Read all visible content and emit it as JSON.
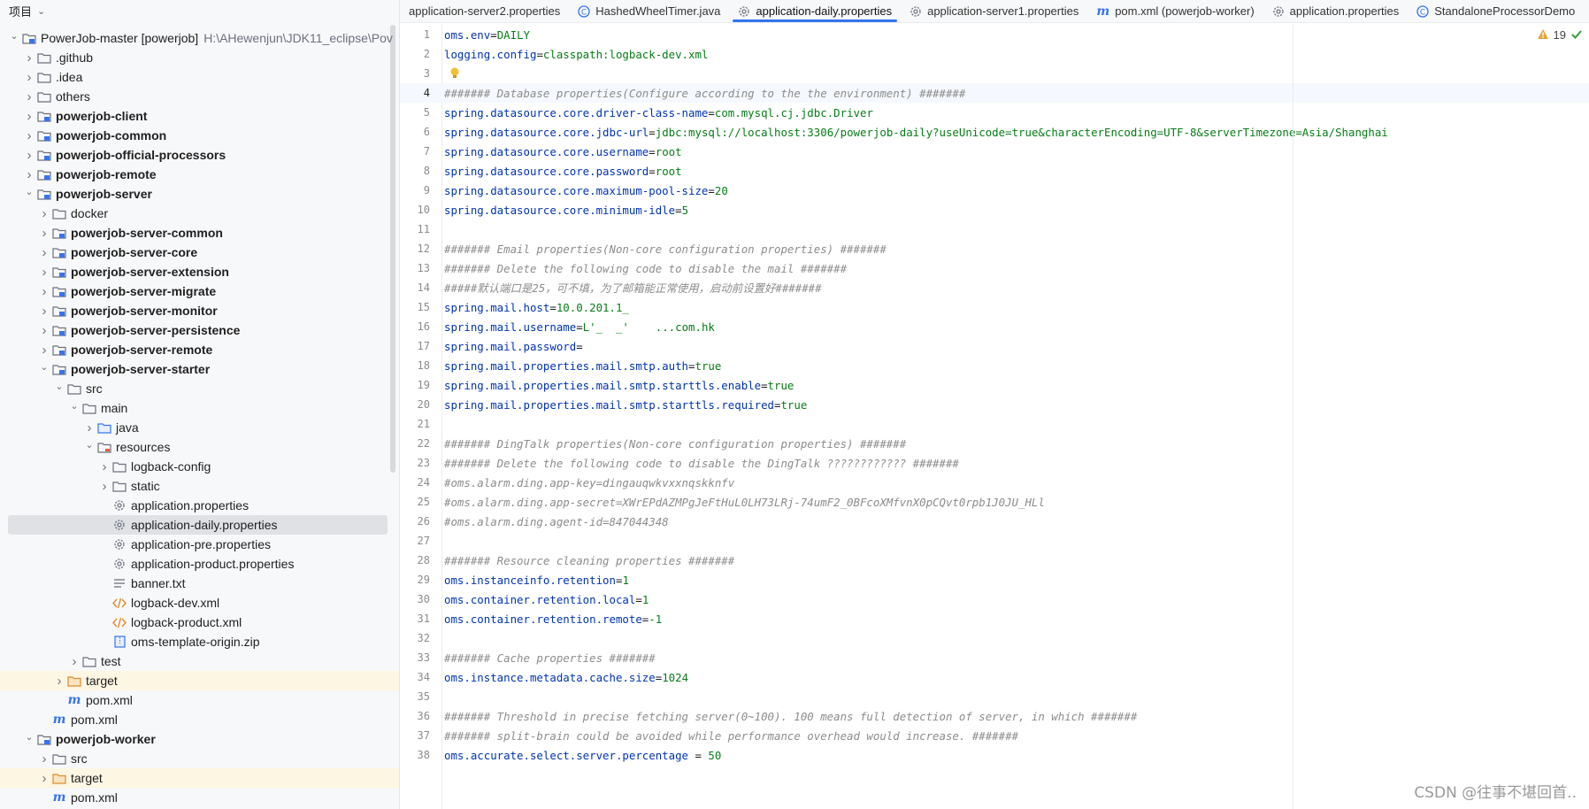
{
  "project_panel": {
    "title": "项目",
    "tree": [
      {
        "indent": 0,
        "arrow": "down",
        "icon": "module",
        "label": "PowerJob-master [powerjob]",
        "suffix": "H:\\AHewenjun\\JDK11_eclipse\\Pov",
        "bold": false
      },
      {
        "indent": 1,
        "arrow": "right",
        "icon": "folder",
        "label": ".github"
      },
      {
        "indent": 1,
        "arrow": "right",
        "icon": "folder",
        "label": ".idea"
      },
      {
        "indent": 1,
        "arrow": "right",
        "icon": "folder",
        "label": "others"
      },
      {
        "indent": 1,
        "arrow": "right",
        "icon": "module",
        "label": "powerjob-client",
        "bold": true
      },
      {
        "indent": 1,
        "arrow": "right",
        "icon": "module",
        "label": "powerjob-common",
        "bold": true
      },
      {
        "indent": 1,
        "arrow": "right",
        "icon": "module",
        "label": "powerjob-official-processors",
        "bold": true
      },
      {
        "indent": 1,
        "arrow": "right",
        "icon": "module",
        "label": "powerjob-remote",
        "bold": true
      },
      {
        "indent": 1,
        "arrow": "down",
        "icon": "module",
        "label": "powerjob-server",
        "bold": true
      },
      {
        "indent": 2,
        "arrow": "right",
        "icon": "folder",
        "label": "docker"
      },
      {
        "indent": 2,
        "arrow": "right",
        "icon": "module",
        "label": "powerjob-server-common",
        "bold": true
      },
      {
        "indent": 2,
        "arrow": "right",
        "icon": "module",
        "label": "powerjob-server-core",
        "bold": true
      },
      {
        "indent": 2,
        "arrow": "right",
        "icon": "module",
        "label": "powerjob-server-extension",
        "bold": true
      },
      {
        "indent": 2,
        "arrow": "right",
        "icon": "module",
        "label": "powerjob-server-migrate",
        "bold": true
      },
      {
        "indent": 2,
        "arrow": "right",
        "icon": "module",
        "label": "powerjob-server-monitor",
        "bold": true
      },
      {
        "indent": 2,
        "arrow": "right",
        "icon": "module",
        "label": "powerjob-server-persistence",
        "bold": true
      },
      {
        "indent": 2,
        "arrow": "right",
        "icon": "module",
        "label": "powerjob-server-remote",
        "bold": true
      },
      {
        "indent": 2,
        "arrow": "down",
        "icon": "module",
        "label": "powerjob-server-starter",
        "bold": true
      },
      {
        "indent": 3,
        "arrow": "down",
        "icon": "folder",
        "label": "src"
      },
      {
        "indent": 4,
        "arrow": "down",
        "icon": "folder",
        "label": "main"
      },
      {
        "indent": 5,
        "arrow": "right",
        "icon": "folder-blue",
        "label": "java"
      },
      {
        "indent": 5,
        "arrow": "down",
        "icon": "folder-res",
        "label": "resources"
      },
      {
        "indent": 6,
        "arrow": "right",
        "icon": "folder",
        "label": "logback-config"
      },
      {
        "indent": 6,
        "arrow": "right",
        "icon": "folder",
        "label": "static"
      },
      {
        "indent": 6,
        "arrow": "none",
        "icon": "gear",
        "label": "application.properties"
      },
      {
        "indent": 6,
        "arrow": "none",
        "icon": "gear",
        "label": "application-daily.properties",
        "selected": true
      },
      {
        "indent": 6,
        "arrow": "none",
        "icon": "gear",
        "label": "application-pre.properties"
      },
      {
        "indent": 6,
        "arrow": "none",
        "icon": "gear",
        "label": "application-product.properties"
      },
      {
        "indent": 6,
        "arrow": "none",
        "icon": "text",
        "label": "banner.txt"
      },
      {
        "indent": 6,
        "arrow": "none",
        "icon": "xml",
        "label": "logback-dev.xml"
      },
      {
        "indent": 6,
        "arrow": "none",
        "icon": "xml",
        "label": "logback-product.xml"
      },
      {
        "indent": 6,
        "arrow": "none",
        "icon": "zip",
        "label": "oms-template-origin.zip"
      },
      {
        "indent": 4,
        "arrow": "right",
        "icon": "folder",
        "label": "test"
      },
      {
        "indent": 3,
        "arrow": "right",
        "icon": "folder-orange",
        "label": "target",
        "excluded": true
      },
      {
        "indent": 3,
        "arrow": "none",
        "icon": "maven",
        "label": "pom.xml"
      },
      {
        "indent": 2,
        "arrow": "none",
        "icon": "maven",
        "label": "pom.xml"
      },
      {
        "indent": 1,
        "arrow": "down",
        "icon": "module",
        "label": "powerjob-worker",
        "bold": true
      },
      {
        "indent": 2,
        "arrow": "right",
        "icon": "folder",
        "label": "src"
      },
      {
        "indent": 2,
        "arrow": "right",
        "icon": "folder-orange",
        "label": "target",
        "excluded": true
      },
      {
        "indent": 2,
        "arrow": "none",
        "icon": "maven",
        "label": "pom.xml"
      }
    ]
  },
  "tabs": [
    {
      "label": "application-server2.properties",
      "icon": "none"
    },
    {
      "label": "HashedWheelTimer.java",
      "icon": "class"
    },
    {
      "label": "application-daily.properties",
      "icon": "gear",
      "active": true
    },
    {
      "label": "application-server1.properties",
      "icon": "gear"
    },
    {
      "label": "pom.xml (powerjob-worker)",
      "icon": "maven"
    },
    {
      "label": "application.properties",
      "icon": "gear"
    },
    {
      "label": "StandaloneProcessorDemo",
      "icon": "class"
    }
  ],
  "inspections": {
    "warnings": "19",
    "warning_color": "#e8a33d",
    "ok_color": "#3a9a3a"
  },
  "editor": {
    "current_line": 4,
    "lines": [
      {
        "k": "oms.env",
        "v": "DAILY"
      },
      {
        "k": "logging.config",
        "v": "classpath:logback-dev.xml"
      },
      {
        "c": ""
      },
      {
        "c": "####### Database properties(Configure according to the the environment) #######"
      },
      {
        "k": "spring.datasource.core.driver-class-name",
        "v": "com.mysql.cj.jdbc.Driver"
      },
      {
        "k": "spring.datasource.core.jdbc-url",
        "v": "jdbc:mysql://localhost:3306/powerjob-daily?useUnicode=true&characterEncoding=UTF-8&serverTimezone=Asia/Shanghai"
      },
      {
        "k": "spring.datasource.core.username",
        "v": "root"
      },
      {
        "k": "spring.datasource.core.password",
        "v": "root"
      },
      {
        "k": "spring.datasource.core.maximum-pool-size",
        "v": "20"
      },
      {
        "k": "spring.datasource.core.minimum-idle",
        "v": "5"
      },
      {
        "c": ""
      },
      {
        "c": "####### Email properties(Non-core configuration properties) #######"
      },
      {
        "c": "####### Delete the following code to disable the mail #######"
      },
      {
        "c": "#####默认端口是25，可不填，为了邮箱能正常使用，启动前设置好#######"
      },
      {
        "k": "spring.mail.host",
        "v": "10.0.201.1_"
      },
      {
        "k": "spring.mail.username",
        "v": "L'_  _'    ...com.hk"
      },
      {
        "k": "spring.mail.password",
        "v": ""
      },
      {
        "k": "spring.mail.properties.mail.smtp.auth",
        "v": "true"
      },
      {
        "k": "spring.mail.properties.mail.smtp.starttls.enable",
        "v": "true"
      },
      {
        "k": "spring.mail.properties.mail.smtp.starttls.required",
        "v": "true"
      },
      {
        "c": ""
      },
      {
        "c": "####### DingTalk properties(Non-core configuration properties) #######"
      },
      {
        "c": "####### Delete the following code to disable the DingTalk ???????????? #######"
      },
      {
        "c": "#oms.alarm.ding.app-key=dingauqwkvxxnqskknfv"
      },
      {
        "c": "#oms.alarm.ding.app-secret=XWrEPdAZMPgJeFtHuL0LH73LRj-74umF2_0BFcoXMfvnX0pCQvt0rpb1J0JU_HLl"
      },
      {
        "c": "#oms.alarm.ding.agent-id=847044348"
      },
      {
        "c": ""
      },
      {
        "c": "####### Resource cleaning properties #######"
      },
      {
        "k": "oms.instanceinfo.retention",
        "v": "1"
      },
      {
        "k": "oms.container.retention.local",
        "v": "1"
      },
      {
        "k": "oms.container.retention.remote",
        "v": "-1"
      },
      {
        "c": ""
      },
      {
        "c": "####### Cache properties #######"
      },
      {
        "k": "oms.instance.metadata.cache.size",
        "v": "1024"
      },
      {
        "c": ""
      },
      {
        "c": "####### Threshold in precise fetching server(0~100). 100 means full detection of server, in which #######"
      },
      {
        "c": "####### split-brain could be avoided while performance overhead would increase. #######"
      },
      {
        "k": "oms.accurate.select.server.percentage",
        "sep": " = ",
        "v": "50"
      }
    ]
  },
  "watermark": "CSDN @往事不堪回首.."
}
